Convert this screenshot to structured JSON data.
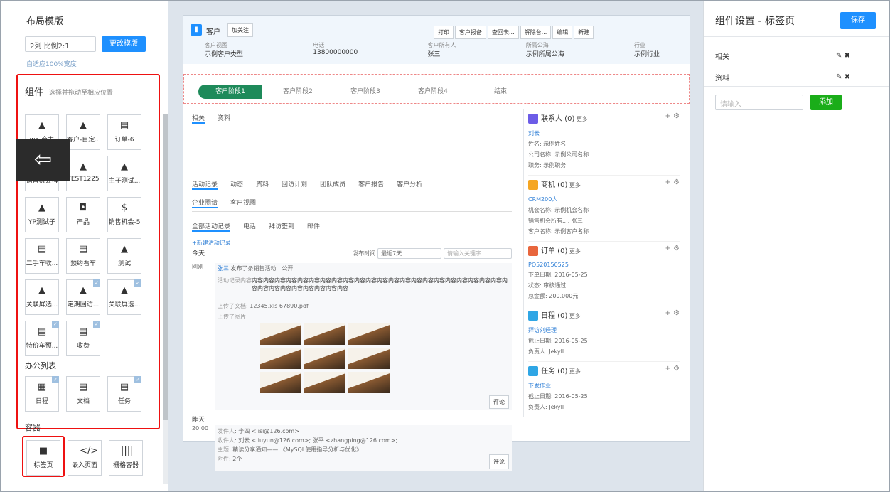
{
  "left": {
    "title": "布局模版",
    "layout_value": "2列 比例2:1",
    "change_btn": "更改模版",
    "adaptive": "自适应100%宽度",
    "components_title": "组件",
    "components_hint": "选择并拖动至相应位置",
    "items": [
      {
        "icon": "▲",
        "label": "wb-商主"
      },
      {
        "icon": "▲",
        "label": "客户-自定..."
      },
      {
        "icon": "▤",
        "label": "订单-6"
      },
      {
        "icon": "▲",
        "label": "销售机会-4"
      },
      {
        "icon": "▲",
        "label": "TEST1225"
      },
      {
        "icon": "▲",
        "label": "主子测试..."
      },
      {
        "icon": "▲",
        "label": "YP测试子"
      },
      {
        "icon": "◘",
        "label": "产品"
      },
      {
        "icon": "$",
        "label": "销售机会-5"
      },
      {
        "icon": "▤",
        "label": "二手车收..."
      },
      {
        "icon": "▤",
        "label": "预约看车"
      },
      {
        "icon": "▲",
        "label": "测试"
      },
      {
        "icon": "▲",
        "label": "关联屏选..."
      },
      {
        "icon": "▲",
        "label": "定期回访..."
      },
      {
        "icon": "▲",
        "label": "关联屏选..."
      },
      {
        "icon": "▤",
        "label": "特价车预..."
      },
      {
        "icon": "▤",
        "label": "收费"
      }
    ],
    "office_title": "办公列表",
    "office": [
      {
        "icon": "▦",
        "label": "日程"
      },
      {
        "icon": "▤",
        "label": "文档"
      },
      {
        "icon": "▤",
        "label": "任务"
      }
    ],
    "container_title": "容器",
    "containers": [
      {
        "icon": "■",
        "label": "标签页"
      },
      {
        "icon": "</>",
        "label": "嵌入页面"
      },
      {
        "icon": "||||",
        "label": "栅格容器"
      }
    ]
  },
  "header": {
    "object": "客户",
    "follow": "加关注",
    "buttons": [
      "打印",
      "客户报备",
      "查回表...",
      "解除台...",
      "编辑",
      "新建"
    ],
    "fields": [
      {
        "label": "客户视图",
        "value": "示例客户类型"
      },
      {
        "label": "电话",
        "value": "13800000000"
      },
      {
        "label": "客户所有人",
        "value": "张三"
      },
      {
        "label": "所属公海",
        "value": "示例所属公海"
      },
      {
        "label": "行业",
        "value": "示例行业"
      }
    ]
  },
  "stages": [
    "客户阶段1",
    "客户阶段2",
    "客户阶段3",
    "客户阶段4",
    "结束"
  ],
  "top_tabs": [
    "相关",
    "资料"
  ],
  "act_tabs": [
    "活动记录",
    "动态",
    "资料",
    "回访计划",
    "团队成员",
    "客户报告",
    "客户分析"
  ],
  "act_tabs2": [
    "企业圈请",
    "客户视图"
  ],
  "sub_tabs": [
    "全部活动记录",
    "电话",
    "拜访签到",
    "邮件"
  ],
  "new_activity": "+新建活动记录",
  "today": "今天",
  "publish": "发布时间",
  "range": "最近7天",
  "search_ph": "请输入关键字",
  "post1": {
    "time": "刚刚",
    "author": "张三",
    "meta": "发布了条销售活动 | 公开",
    "label": "活动记录内容",
    "text": "内容内容内容内容内容内容内容内容内容内容内容内容内容内容内容内容内容内容内容内容内容内容内容内容内容内容内容内容内容内容内容",
    "files_label": "上传了文档",
    "files": "12345.xls  67890.pdf",
    "imgs_label": "上传了图片",
    "comment": "评论"
  },
  "yesterday": "昨天",
  "post2": {
    "time": "20:00",
    "from_l": "发件人",
    "from": "李四 <lisi@126.com>",
    "to_l": "收件人",
    "to": "刘云 <liuyun@126.com>; 张平 <zhangping@126.com>;",
    "subj_l": "主题",
    "subj": "精读分享通知—— 《MySQL使用指导分析与优化》",
    "att_l": "附件",
    "att": "2个",
    "comment": "评论"
  },
  "side_cards": [
    {
      "title": "联系人 (0)",
      "more": "更多",
      "color": "#6c5ce7",
      "name": "刘云",
      "lines": [
        [
          "姓名",
          "示例姓名"
        ],
        [
          "公司名称",
          "示例公司名称"
        ],
        [
          "职务",
          "示例职务"
        ]
      ]
    },
    {
      "title": "商机 (0)",
      "more": "更多",
      "color": "#f5a623",
      "name": "CRM200人",
      "lines": [
        [
          "机会名称",
          "示例机会名称"
        ],
        [
          "销售机会所有...",
          "张三"
        ],
        [
          "客户名称",
          "示例客户名称"
        ]
      ]
    },
    {
      "title": "订单 (0)",
      "more": "更多",
      "color": "#e8663d",
      "name": "PO520150525",
      "lines": [
        [
          "下单日期",
          "2016-05-25"
        ],
        [
          "状态",
          "审核通过"
        ],
        [
          "总金额",
          "200.000元"
        ]
      ]
    },
    {
      "title": "日程 (0)",
      "more": "更多",
      "color": "#2fa6e5",
      "name": "拜访刘经理",
      "lines": [
        [
          "截止日期",
          "2016-05-25"
        ],
        [
          "负责人",
          "Jekyll"
        ]
      ]
    },
    {
      "title": "任务 (0)",
      "more": "更多",
      "color": "#2fa6e5",
      "name": "下发作业",
      "lines": [
        [
          "截止日期",
          "2016-05-25"
        ],
        [
          "负责人",
          "Jekyll"
        ]
      ]
    }
  ],
  "right": {
    "title": "组件设置 - 标签页",
    "save": "保存",
    "tabs": [
      "相关",
      "资料"
    ],
    "input_ph": "请输入",
    "add": "添加"
  }
}
